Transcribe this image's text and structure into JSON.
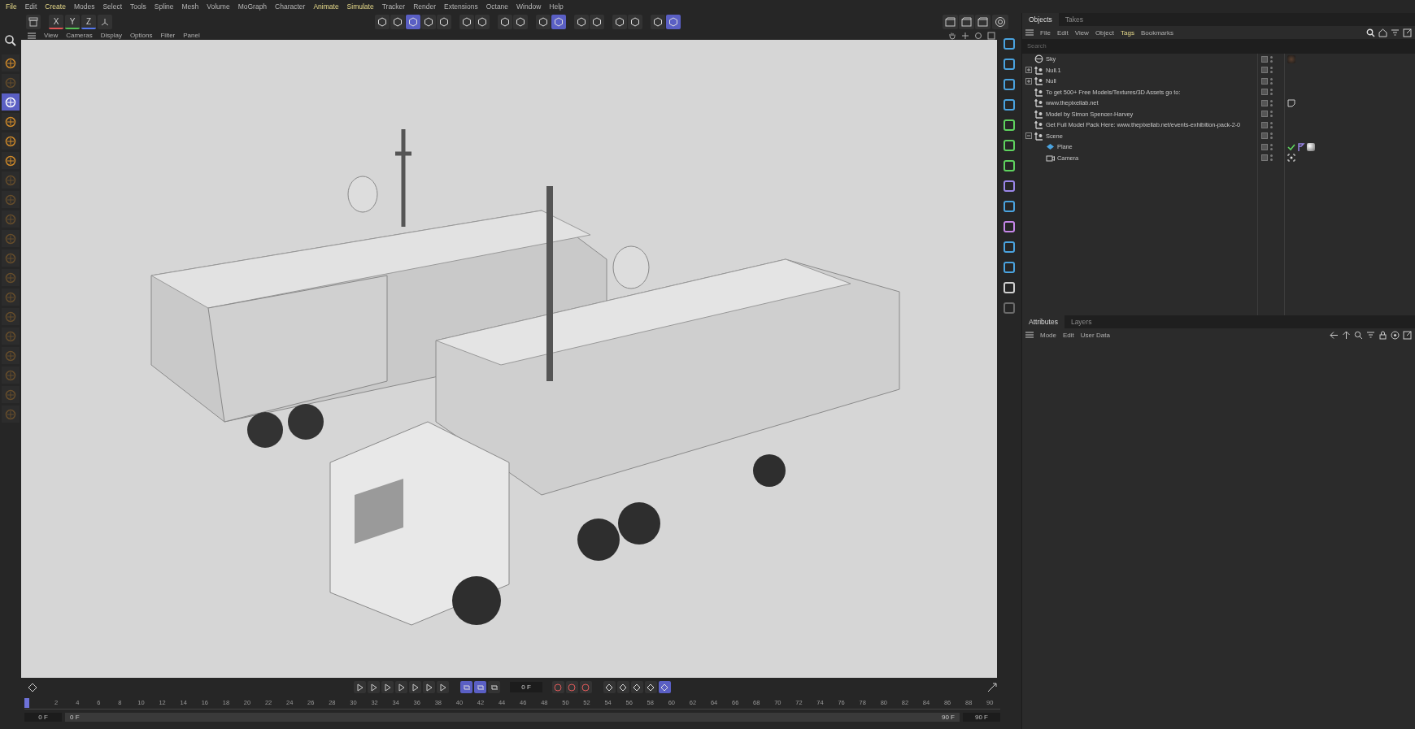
{
  "menu": [
    {
      "label": "File",
      "highlight": true
    },
    {
      "label": "Edit",
      "highlight": false
    },
    {
      "label": "Create",
      "highlight": true
    },
    {
      "label": "Modes",
      "highlight": false
    },
    {
      "label": "Select",
      "highlight": false
    },
    {
      "label": "Tools",
      "highlight": false
    },
    {
      "label": "Spline",
      "highlight": false
    },
    {
      "label": "Mesh",
      "highlight": false
    },
    {
      "label": "Volume",
      "highlight": false
    },
    {
      "label": "MoGraph",
      "highlight": false
    },
    {
      "label": "Character",
      "highlight": false
    },
    {
      "label": "Animate",
      "highlight": true
    },
    {
      "label": "Simulate",
      "highlight": true
    },
    {
      "label": "Tracker",
      "highlight": false
    },
    {
      "label": "Render",
      "highlight": false
    },
    {
      "label": "Extensions",
      "highlight": false
    },
    {
      "label": "Octane",
      "highlight": false
    },
    {
      "label": "Window",
      "highlight": false
    },
    {
      "label": "Help",
      "highlight": false
    }
  ],
  "axis_buttons": [
    {
      "label": "X",
      "kind": "x"
    },
    {
      "label": "Y",
      "kind": "y"
    },
    {
      "label": "Z",
      "kind": "z"
    }
  ],
  "top_toolbar": [
    [
      {
        "selected": false
      },
      {
        "selected": false
      },
      {
        "selected": true
      },
      {
        "selected": false
      },
      {
        "selected": false
      }
    ],
    [
      {
        "selected": false
      },
      {
        "selected": false
      }
    ],
    [
      {
        "selected": false
      },
      {
        "selected": false
      }
    ],
    [
      {
        "selected": false
      },
      {
        "selected": true
      }
    ],
    [
      {
        "selected": false
      },
      {
        "selected": false
      }
    ],
    [
      {
        "selected": false
      },
      {
        "selected": false
      }
    ],
    [
      {
        "selected": false
      },
      {
        "selected": true
      }
    ]
  ],
  "left_tools": [
    {
      "selected": false,
      "disabled": false
    },
    {
      "selected": false,
      "disabled": true
    },
    {
      "selected": true,
      "disabled": false
    },
    {
      "selected": false,
      "disabled": false
    },
    {
      "selected": false,
      "disabled": false
    },
    {
      "selected": false,
      "disabled": false
    },
    {
      "selected": false,
      "disabled": true
    },
    {
      "selected": false,
      "disabled": true
    },
    {
      "selected": false,
      "disabled": true
    },
    {
      "selected": false,
      "disabled": true
    },
    {
      "selected": false,
      "disabled": true
    },
    {
      "selected": false,
      "disabled": true
    },
    {
      "selected": false,
      "disabled": true
    },
    {
      "selected": false,
      "disabled": true
    },
    {
      "selected": false,
      "disabled": true
    },
    {
      "selected": false,
      "disabled": true
    },
    {
      "selected": false,
      "disabled": true
    },
    {
      "selected": false,
      "disabled": true
    },
    {
      "selected": false,
      "disabled": true
    }
  ],
  "viewport_menu": [
    "View",
    "Cameras",
    "Display",
    "Options",
    "Filter",
    "Panel"
  ],
  "object_tools": [
    {
      "color": "#4aa3df"
    },
    {
      "color": "#4aa3df"
    },
    {
      "color": "#4aa3df"
    },
    {
      "color": "#4aa3df"
    },
    {
      "color": "#5fd35f"
    },
    {
      "color": "#5fd35f"
    },
    {
      "color": "#5fd35f"
    },
    {
      "color": "#9a86e8"
    },
    {
      "color": "#4aa3df"
    },
    {
      "color": "#c586e8"
    },
    {
      "color": "#4aa3df"
    },
    {
      "color": "#4aa3df"
    },
    {
      "color": "#cfcfcf"
    },
    {
      "color": "#6a6a6a"
    }
  ],
  "objects_tabs": [
    {
      "label": "Objects",
      "selected": true
    },
    {
      "label": "Takes",
      "selected": false
    }
  ],
  "objects_menu": [
    {
      "label": "File",
      "highlight": false
    },
    {
      "label": "Edit",
      "highlight": false
    },
    {
      "label": "View",
      "highlight": false
    },
    {
      "label": "Object",
      "highlight": false
    },
    {
      "label": "Tags",
      "highlight": true
    },
    {
      "label": "Bookmarks",
      "highlight": false
    }
  ],
  "search": {
    "placeholder": "Search"
  },
  "objects": [
    {
      "name": "Sky",
      "kind": "sky",
      "tags": [
        {
          "kind": "sky-material"
        }
      ]
    },
    {
      "name": "Null.1",
      "kind": "null",
      "expanded": false
    },
    {
      "name": "Null",
      "kind": "null",
      "expanded": false
    },
    {
      "name": "To get 500+ Free Models/Textures/3D Assets go to:",
      "kind": "null"
    },
    {
      "name": "www.thepixellab.net",
      "kind": "null",
      "tags": [
        {
          "kind": "note"
        }
      ]
    },
    {
      "name": "Model by Simon Spencer-Harvey",
      "kind": "null"
    },
    {
      "name": "Get Full Model Pack Here: www.thepixellab.net/events-exhibition-pack-2-0",
      "kind": "null"
    },
    {
      "name": "Scene",
      "kind": "null",
      "expanded": true,
      "children": [
        {
          "name": "Plane",
          "kind": "plane",
          "tags": [
            {
              "kind": "check"
            },
            {
              "kind": "phong"
            },
            {
              "kind": "material"
            }
          ]
        },
        {
          "name": "Camera",
          "kind": "camera",
          "tags": [
            {
              "kind": "target"
            }
          ]
        }
      ]
    }
  ],
  "attributes_tabs": [
    {
      "label": "Attributes",
      "selected": true
    },
    {
      "label": "Layers",
      "selected": false
    }
  ],
  "attributes_menu": [
    "Mode",
    "Edit",
    "User Data"
  ],
  "timeline": {
    "current_frame": "0 F",
    "transport": [
      {
        "selected": false
      },
      {
        "selected": false
      },
      {
        "selected": false
      },
      {
        "selected": false
      },
      {
        "selected": false
      },
      {
        "selected": false
      },
      {
        "selected": false
      }
    ],
    "modes": [
      {
        "selected": true
      },
      {
        "selected": true
      },
      {
        "selected": false
      }
    ],
    "keys": [
      {
        "selected": false
      },
      {
        "selected": false
      },
      {
        "selected": false
      }
    ],
    "key_modes": [
      {
        "selected": false
      },
      {
        "selected": false
      },
      {
        "selected": false
      },
      {
        "selected": false
      },
      {
        "selected": true
      }
    ],
    "ruler": [
      "2",
      "4",
      "6",
      "8",
      "10",
      "12",
      "14",
      "16",
      "18",
      "20",
      "22",
      "24",
      "26",
      "28",
      "30",
      "32",
      "34",
      "36",
      "38",
      "40",
      "42",
      "44",
      "46",
      "48",
      "50",
      "52",
      "54",
      "56",
      "58",
      "60",
      "62",
      "64",
      "66",
      "68",
      "70",
      "72",
      "74",
      "76",
      "78",
      "80",
      "82",
      "84",
      "86",
      "88",
      "90"
    ],
    "playhead": {
      "level": 0
    },
    "range": {
      "level": 1
    },
    "start_field": "0 F",
    "range_start": "0 F",
    "range_end": "90 F",
    "end_field": "90 F"
  }
}
